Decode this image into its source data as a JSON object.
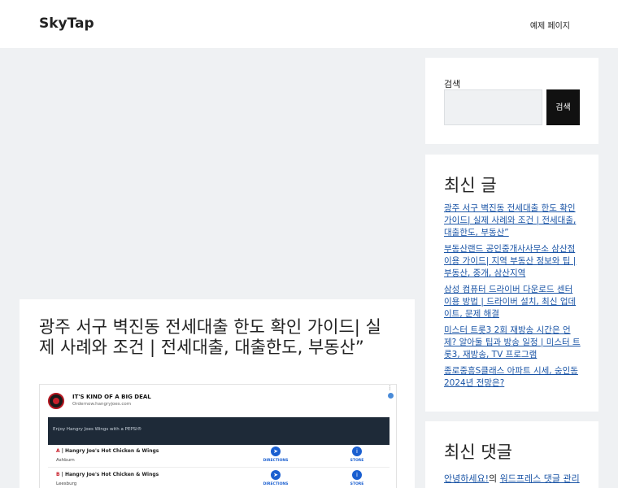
{
  "header": {
    "site_title": "SkyTap",
    "nav_item": "예제 페이지"
  },
  "article": {
    "title": "광주 서구 벽진동 전세대출 한도 확인 가이드| 실제 사례와 조건 | 전세대출, 대출한도, 부동산”"
  },
  "ad": {
    "headline": "IT'S KIND OF A BIG DEAL",
    "domain": "Ordernow.hangryjoes.com",
    "band_text": "Enjoy Hangry Joes Wings with a PEPSI®",
    "directions_label": "DIRECTIONS",
    "store_label": "STORE",
    "rows": [
      {
        "letter": "A",
        "name": "Hangry Joe's Hot Chicken & Wings",
        "city": "Ashburn"
      },
      {
        "letter": "B",
        "name": "Hangry Joe's Hot Chicken & Wings",
        "city": "Leesburg"
      }
    ]
  },
  "sidebar": {
    "search": {
      "label": "검색",
      "input_value": "",
      "button_label": "검색"
    },
    "recent_posts": {
      "title": "최신 글",
      "items": [
        "광주 서구 벽진동 전세대출 한도 확인 가이드| 실제 사례와 조건 | 전세대출, 대출한도, 부동산”",
        "부동산랜드 공인중개사사무소 삼산점 이용 가이드| 지역 부동산 정보와 팁 | 부동산, 중개, 삼산지역",
        "삼성 컴퓨터 드라이버 다운로드 센터 이용 방법 | 드라이버 설치, 최신 업데이트, 문제 해결",
        "미스터 트롯3 2회 재방송 시간은 언제? 알아둘 팁과 방송 일정 | 미스터 트롯3, 재방송, TV 프로그램",
        "종로중흥S클래스 아파트 시세, 숭인동 2024년 전망은?"
      ]
    },
    "recent_comments": {
      "title": "최신 댓글",
      "author": "안녕하세요!",
      "connector": "의",
      "post_link": "워드프레스 댓글 관리"
    }
  },
  "colors": {
    "page_bg": "#eff1f3",
    "card_bg": "#ffffff",
    "link": "#1b55a6",
    "button_bg": "#111111"
  }
}
